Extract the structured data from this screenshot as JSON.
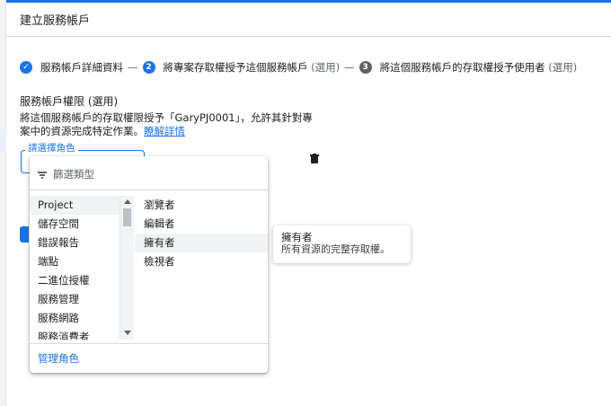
{
  "page": {
    "title": "建立服務帳戶"
  },
  "stepper": {
    "steps": [
      {
        "number": "",
        "label": "服務帳戶詳細資料",
        "optional": ""
      },
      {
        "number": "2",
        "label": "將專案存取權授予這個服務帳戶",
        "optional": "(選用)"
      },
      {
        "number": "3",
        "label": "將這個服務帳戶的存取權授予使用者",
        "optional": "(選用)"
      }
    ],
    "separator": "—"
  },
  "permissions": {
    "title": "服務帳戶權限 (選用)",
    "desc_line1": "將這個服務帳戶的存取權限授予「GaryPJ0001」，允許其針對專",
    "desc_line2": "案中的資源完成特定作業。",
    "learn_more": "瞭解詳情"
  },
  "role_select": {
    "label": "請選擇角色",
    "value": ""
  },
  "dropdown": {
    "filter_placeholder": "篩選類型",
    "categories": [
      "Project",
      "儲存空間",
      "錯誤報告",
      "端點",
      "二進位授權",
      "服務管理",
      "服務網路",
      "服務消費者"
    ],
    "selected_category": "Project",
    "roles": [
      "瀏覽者",
      "編輯者",
      "擁有者",
      "檢視者"
    ],
    "hovered_role": "擁有者",
    "manage_roles": "管理角色"
  },
  "tooltip": {
    "title": "擁有者",
    "description": "所有資源的完整存取權。"
  },
  "colors": {
    "accent": "#1a73e8",
    "muted": "#5f6368",
    "hover": "#f1f3f4"
  }
}
